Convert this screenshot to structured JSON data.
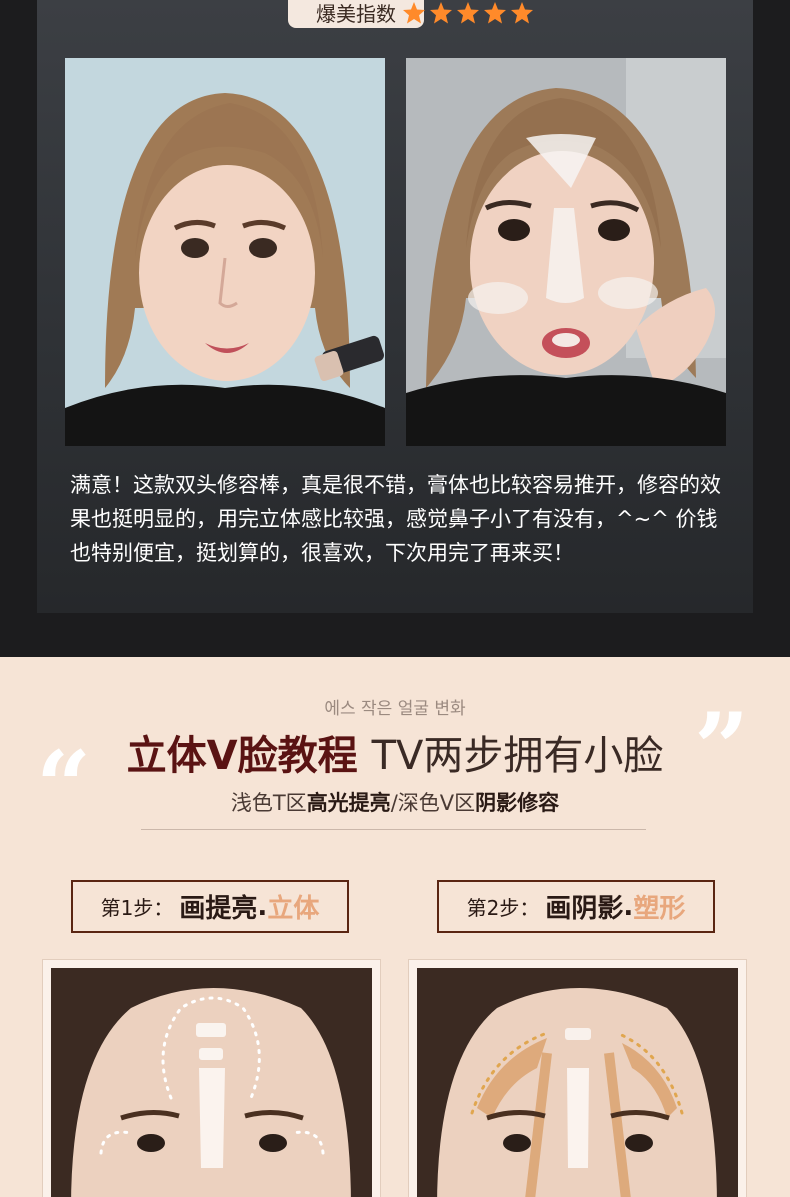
{
  "review_card": {
    "rating_label": "爆美指数",
    "star_count": 5,
    "star_color": "#ff8a2a",
    "photos": [
      {
        "name": "before-photo"
      },
      {
        "name": "after-photo"
      }
    ],
    "review_text": "满意！这款双头修容棒，真是很不错，膏体也比较容易推开，修容的效果也挺明显的，用完立体感比较强，感觉鼻子小了有没有，^~^ 价钱也特别便宜，挺划算的，很喜欢，下次用完了再来买！"
  },
  "tutorial": {
    "korean_caption": "에스 작은 얼굴 변화",
    "headline_strong": "立体V脸教程",
    "headline_light": "TV两步拥有小脸",
    "sub_parts": [
      "浅色T区",
      "高光提亮",
      "/深色V区",
      "阴影修容"
    ],
    "steps": [
      {
        "num": "第1步：",
        "verb": "画提亮",
        "dot": ".",
        "accent": "立体"
      },
      {
        "num": "第2步：",
        "verb": "画阴影",
        "dot": ".",
        "accent": "塑形"
      }
    ],
    "accent_color": "#e8a77d",
    "headline_color": "#5a1313"
  }
}
